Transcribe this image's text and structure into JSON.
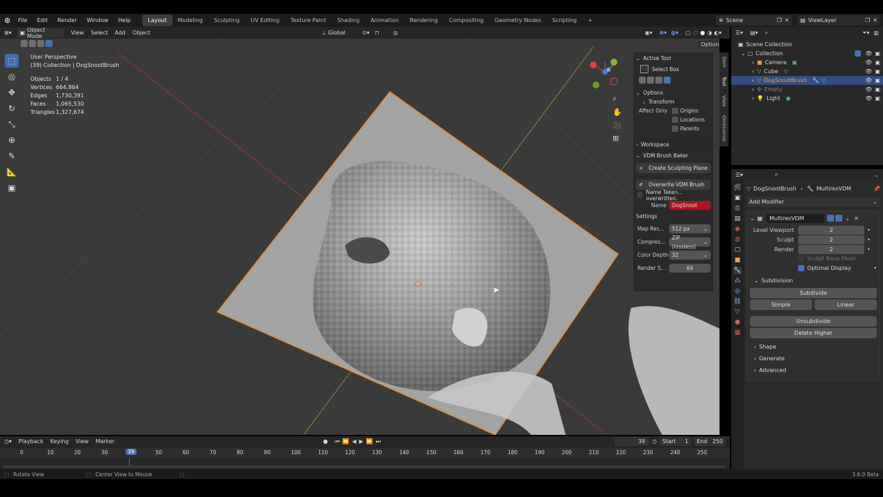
{
  "app": {
    "logo_icon": "blender-icon",
    "version": "3.6.0 Beta"
  },
  "menu": [
    "File",
    "Edit",
    "Render",
    "Window",
    "Help"
  ],
  "workspaces": [
    "Layout",
    "Modeling",
    "Sculpting",
    "UV Editing",
    "Texture Paint",
    "Shading",
    "Animation",
    "Rendering",
    "Compositing",
    "Geometry Nodes",
    "Scripting"
  ],
  "workspace_add": "+",
  "scene": {
    "label": "Scene",
    "viewlayer": "ViewLayer"
  },
  "viewport_header": {
    "mode": "Object Mode",
    "menus": [
      "View",
      "Select",
      "Add",
      "Object"
    ],
    "orientation": "Global",
    "options": "Options"
  },
  "overlay": {
    "perspective": "User Perspective",
    "collection": "(39) Collection | DogSnootBrush",
    "stats": [
      {
        "k": "Objects",
        "v": "1 / 4"
      },
      {
        "k": "Vertices",
        "v": "664,864"
      },
      {
        "k": "Edges",
        "v": "1,730,391"
      },
      {
        "k": "Faces",
        "v": "1,065,530"
      },
      {
        "k": "Triangles",
        "v": "1,327,674"
      }
    ]
  },
  "sidebar": {
    "tabs": [
      "Item",
      "Tool",
      "View",
      "Omniverse"
    ],
    "active_tool": "Active Tool",
    "select_box": "Select Box",
    "options": "Options",
    "transform": "Transform",
    "affect_only": "Affect Only",
    "affect": [
      "Origins",
      "Locations",
      "Parents"
    ],
    "workspace": "Workspace",
    "vdm": "VDM Brush Baker",
    "create_plane": "Create Sculpting Plane",
    "overwrite": "Overwrite VDM Brush",
    "name_taken": "Name Taken... overwritten.",
    "name_label": "Name",
    "name_value": "DogSnoot",
    "settings": "Settings",
    "settings_rows": [
      {
        "k": "Map Res...",
        "v": "512 px"
      },
      {
        "k": "Compres...",
        "v": "ZIP (lossless)"
      },
      {
        "k": "Color Depth",
        "v": "32"
      },
      {
        "k": "Render S...",
        "v": "64"
      }
    ]
  },
  "outliner": {
    "scene_collection": "Scene Collection",
    "collection": "Collection",
    "items": [
      {
        "name": "Camera",
        "color": "#d49b5a"
      },
      {
        "name": "Cube",
        "color": "#d49b5a"
      },
      {
        "name": "DogSnootBrush",
        "color": "#d49b5a"
      },
      {
        "name": "Empty",
        "color": "#888888"
      },
      {
        "name": "Light",
        "color": "#d49b5a"
      }
    ]
  },
  "properties": {
    "breadcrumb_obj": "DogSnootBrush",
    "breadcrumb_mod": "MultiresVDM",
    "add_modifier": "Add Modifier",
    "modifier_name": "MultiresVDM",
    "levels": [
      {
        "k": "Level Viewport",
        "v": "2"
      },
      {
        "k": "Sculpt",
        "v": "2"
      },
      {
        "k": "Render",
        "v": "2"
      }
    ],
    "sculpt_base_mesh": "Sculpt Base Mesh",
    "optimal_display": "Optimal Display",
    "subdivision": "Subdivision",
    "subdivide": "Subdivide",
    "simple": "Simple",
    "linear": "Linear",
    "unsubdivide": "Unsubdivide",
    "delete_higher": "Delete Higher",
    "sections": [
      "Shape",
      "Generate",
      "Advanced"
    ]
  },
  "timeline": {
    "menus": [
      "Playback",
      "Keying",
      "View",
      "Marker"
    ],
    "current": "39",
    "start_label": "Start",
    "start": "1",
    "end_label": "End",
    "end": "250",
    "ticks": [
      "0",
      "10",
      "20",
      "30",
      "39",
      "50",
      "60",
      "70",
      "80",
      "90",
      "100",
      "110",
      "120",
      "130",
      "140",
      "150",
      "160",
      "170",
      "180",
      "190",
      "200",
      "210",
      "220",
      "230",
      "240",
      "250"
    ]
  },
  "status": {
    "left": "Rotate View",
    "center": "Center View to Mouse"
  },
  "colors": {
    "accent": "#4772b3",
    "selected_row": "#334d80",
    "name_field": "#b0141c",
    "orange": "#e2852c"
  }
}
